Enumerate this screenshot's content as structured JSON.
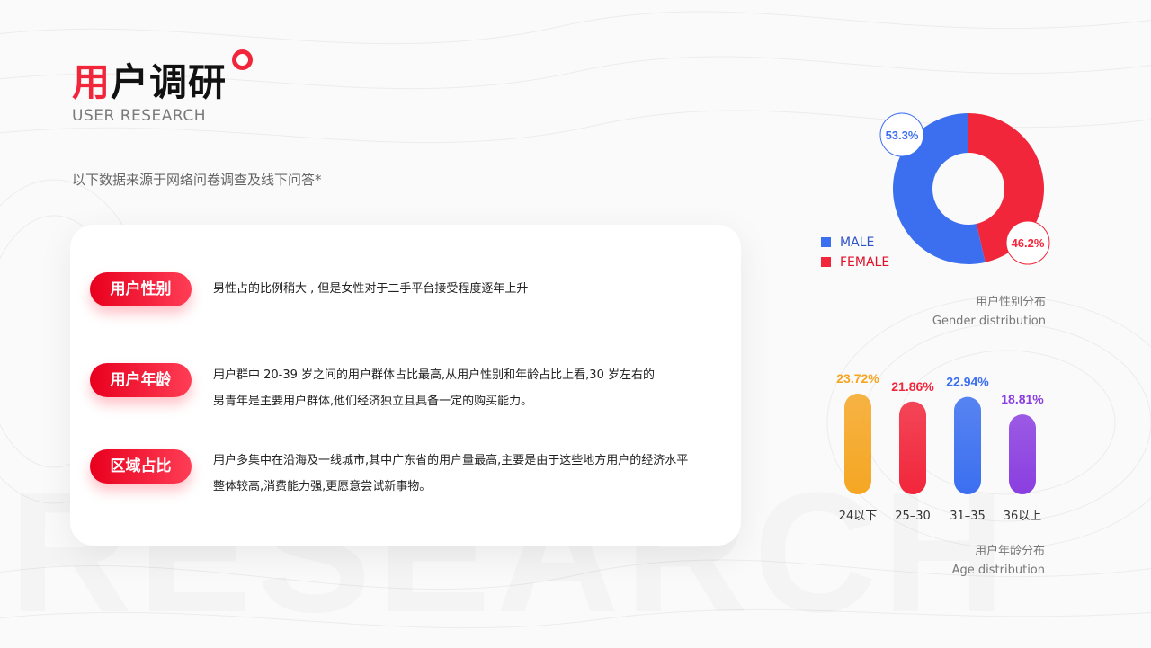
{
  "header": {
    "title_accent": "用",
    "title_rest": "户调研",
    "subtitle": "USER RESEARCH",
    "description": "以下数据来源于网络问卷调查及线下问答*"
  },
  "background_word": "RESEARCH",
  "sections": [
    {
      "label": "用户性别",
      "lines": [
        "男性占的比例稍大 , 但是女性对于二手平台接受程度逐年上升"
      ]
    },
    {
      "label": "用户年龄",
      "lines": [
        "用户群中 20-39 岁之间的用户群体占比最高,从用户性别和年龄占比上看,30 岁左右的",
        "男青年是主要用户群体,他们经济独立且具备一定的购买能力。"
      ]
    },
    {
      "label": "区域占比",
      "lines": [
        "用户多集中在沿海及一线城市,其中广东省的用户量最高,主要是由于这些地方用户的经济水平",
        "整体较高,消费能力强,更愿意尝试新事物。"
      ]
    }
  ],
  "chart_data": [
    {
      "type": "pie",
      "categories": [
        "MALE",
        "FEMALE"
      ],
      "values": [
        53.3,
        46.2
      ],
      "value_labels": [
        "53.3%",
        "46.2%"
      ],
      "colors": [
        "#3b6ff0",
        "#f2263b"
      ],
      "caption_cn": "用户性别分布",
      "caption_en": "Gender distribution",
      "legend": "left"
    },
    {
      "type": "bar",
      "categories": [
        "24以下",
        "25–30",
        "31–35",
        "36以上"
      ],
      "values": [
        23.72,
        21.86,
        22.94,
        18.81
      ],
      "value_labels": [
        "23.72%",
        "21.86%",
        "22.94%",
        "18.81%"
      ],
      "colors": [
        "#f5a623",
        "#f2263b",
        "#3b6ff0",
        "#8a3ee0"
      ],
      "caption_cn": "用户年龄分布",
      "caption_en": "Age distribution"
    }
  ]
}
